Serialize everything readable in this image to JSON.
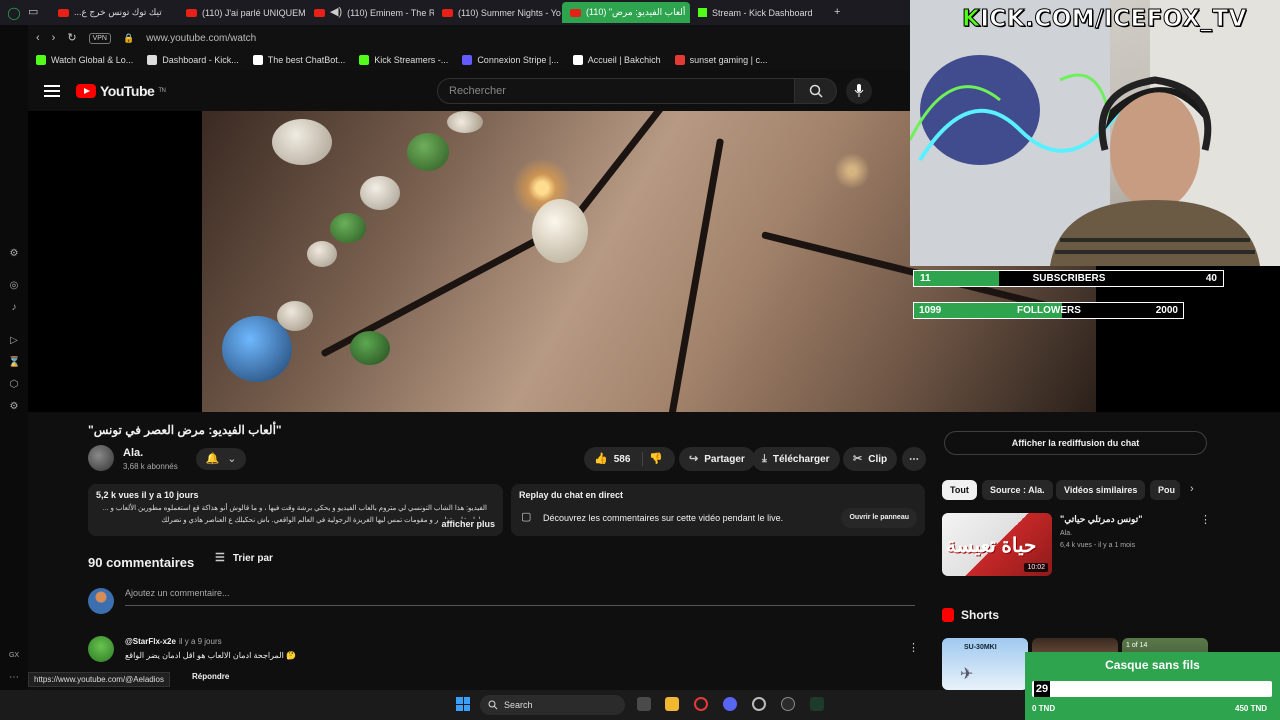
{
  "tabs": [
    {
      "label": "تيك توك تونس خرج ع...",
      "icon": "youtube-icon"
    },
    {
      "label": "(110) J'ai parlé UNIQUEM",
      "icon": "youtube-icon"
    },
    {
      "label": "(110) Eminem - The R",
      "icon": "youtube-icon"
    },
    {
      "label": "(110) Summer Nights - Yo",
      "icon": "youtube-icon"
    },
    {
      "label": "(110) \"ألعاب الفيديو: مرض",
      "icon": "youtube-icon",
      "active": true
    },
    {
      "label": "Stream - Kick Dashboard",
      "icon": "kick-icon"
    }
  ],
  "address": {
    "vpn": "VPN",
    "url": "www.youtube.com/watch"
  },
  "bookmarks": [
    {
      "label": "Watch Global & Lo...",
      "color": "#53fc18"
    },
    {
      "label": "Dashboard - Kick...",
      "color": "#dddddd"
    },
    {
      "label": "The best ChatBot...",
      "color": "#ffffff"
    },
    {
      "label": "Kick Streamers -...",
      "color": "#53fc18"
    },
    {
      "label": "Connexion Stripe |...",
      "color": "#635bff"
    },
    {
      "label": "Accueil | Bakchich",
      "color": "#ffffff"
    },
    {
      "label": "sunset gaming | c...",
      "color": "#e53935"
    }
  ],
  "youtube": {
    "logo": "YouTube",
    "logo_sup": "TN",
    "search_placeholder": "Rechercher"
  },
  "video": {
    "title": "\"ألعاب الفيديو: مرض العصر في تونس\"",
    "channel": "Ala.",
    "subscribers": "3,68 k abonnés",
    "likes": "586",
    "share": "Partager",
    "download": "Télécharger",
    "clip": "Clip",
    "views_date": "5,2 k vues  il y a 10 jours",
    "description": "الفيديو: هذا الشاب التونسي لي متروم بالعاب الفيديو و يحكي برشة وقت فيها ، و ما قالوش أنو هذاكة قع استعملوه مطورين الألعاب و ... بحاولو على عناصر و مقومات تمس ليها الغريزة الرجولية في العالم الواقعي. باش نحكيلك ع العناصر هاذي و نضرلك",
    "show_more": "afficher plus",
    "replay_title": "Replay du chat en direct",
    "replay_text": "Découvrez les commentaires sur cette vidéo pendant le live.",
    "replay_button": "Ouvrir le panneau"
  },
  "comments": {
    "count": "90 commentaires",
    "sort": "Trier par",
    "add_placeholder": "Ajoutez un commentaire...",
    "first": {
      "author": "@StarFlx-x2e",
      "time": "il y a 9 jours",
      "text": "المراجحة ادمان الالعاب هو اقل ادمان يضر الواقع 🤔",
      "reply": "Répondre"
    }
  },
  "status_url": "https://www.youtube.com/@Aeladios",
  "sidebar": {
    "chat_replay": "Afficher la rediffusion du chat",
    "chips": [
      "Tout",
      "Source : Ala.",
      "Vidéos similaires",
      "Pou"
    ],
    "related": {
      "title": "\"تونس دمرتلي حياتي\"",
      "channel": "Ala.",
      "meta": "6,4 k vues - il y a 1 mois",
      "thumb_text": "حياة تعيسة",
      "duration": "10:02"
    },
    "shorts": "Shorts",
    "shorts_labels": [
      "SU-30MKI",
      "",
      "1 of 14"
    ]
  },
  "overlay": {
    "kick_url_k": "K",
    "kick_url_rest": "ICK.COM/ICEFOX_TV",
    "subscribers": {
      "label": "SUBSCRIBERS",
      "current": "11",
      "goal": "40",
      "fraction": 0.275
    },
    "followers": {
      "label": "FOLLOWERS",
      "current": "1099",
      "goal": "2000",
      "fraction": 0.55
    },
    "goal": {
      "title": "Casque sans fils",
      "value": "29",
      "min": "0 TND",
      "max": "450 TND",
      "fraction": 0.064
    }
  },
  "left_bar_labels": [
    "GX"
  ],
  "taskbar": {
    "search": "Search"
  }
}
